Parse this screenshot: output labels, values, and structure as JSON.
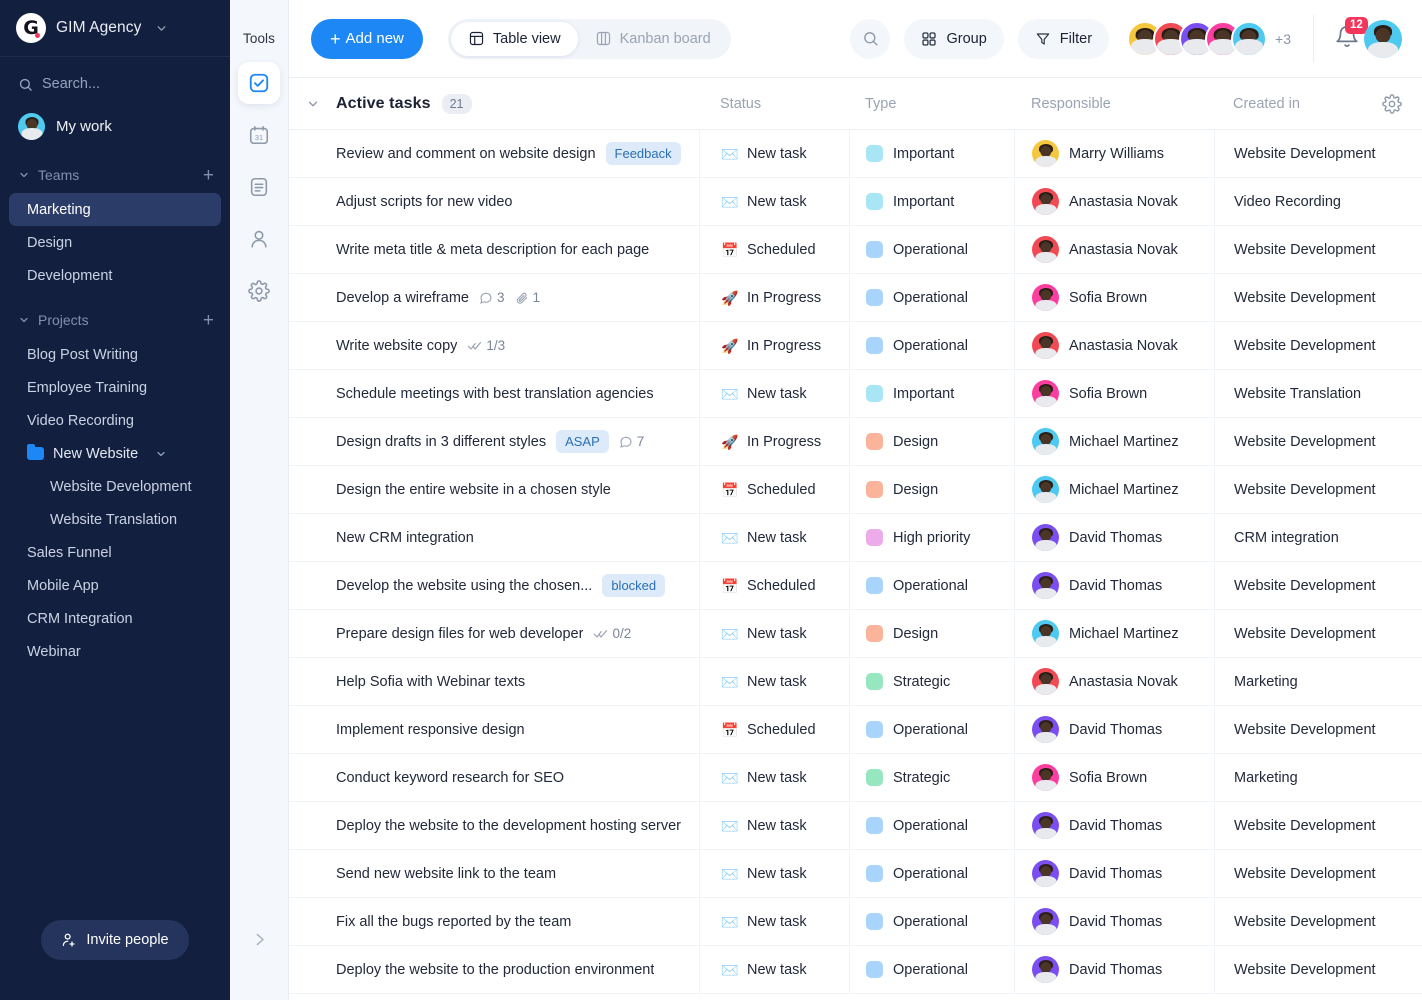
{
  "sidebar": {
    "brand": {
      "name": "GIM Agency",
      "logo_letter": "G",
      "caret_icon": "chevron-down-icon"
    },
    "search": {
      "placeholder": "Search...",
      "icon": "search-icon"
    },
    "my_work": {
      "label": "My work",
      "avatar": "user-avatar"
    },
    "teams": {
      "title": "Teams",
      "add_label": "+",
      "items": [
        {
          "label": "Marketing",
          "active": true
        },
        {
          "label": "Design",
          "active": false
        },
        {
          "label": "Development",
          "active": false
        }
      ]
    },
    "projects": {
      "title": "Projects",
      "add_label": "+",
      "items": [
        {
          "label": "Blog Post Writing",
          "type": "item"
        },
        {
          "label": "Employee Training",
          "type": "item"
        },
        {
          "label": "Video Recording",
          "type": "item"
        },
        {
          "label": "New Website",
          "type": "folder"
        },
        {
          "label": "Website Development",
          "type": "sub"
        },
        {
          "label": "Website Translation",
          "type": "sub"
        },
        {
          "label": "Sales Funnel",
          "type": "item"
        },
        {
          "label": "Mobile App",
          "type": "item"
        },
        {
          "label": "CRM Integration",
          "type": "item"
        },
        {
          "label": "Webinar",
          "type": "item"
        }
      ]
    },
    "invite": {
      "label": "Invite people",
      "icon": "user-plus-icon"
    }
  },
  "rail": {
    "title": "Tools",
    "items": [
      {
        "icon": "checkbox-check-icon",
        "active": true
      },
      {
        "icon": "calendar-icon",
        "active": false
      },
      {
        "icon": "document-icon",
        "active": false
      },
      {
        "icon": "person-icon",
        "active": false
      },
      {
        "icon": "gear-icon",
        "active": false
      }
    ],
    "expand_icon": "chevron-right-icon"
  },
  "topbar": {
    "add_new": "+ Add new",
    "add_new_label": "Add new",
    "views": [
      {
        "label": "Table view",
        "icon": "table-icon",
        "active": true
      },
      {
        "label": "Kanban board",
        "icon": "kanban-icon",
        "active": false
      }
    ],
    "search_icon": "search-icon",
    "group": {
      "label": "Group",
      "icon": "grid-icon"
    },
    "filter": {
      "label": "Filter",
      "icon": "funnel-icon"
    },
    "avatars_more": "+3",
    "notifications": {
      "count": "12",
      "icon": "bell-icon"
    },
    "profile": {
      "icon": "user-avatar"
    }
  },
  "table": {
    "group": {
      "label": "Active tasks",
      "count": "21",
      "toggle_icon": "chevron-down-icon"
    },
    "settings_icon": "gear-icon",
    "columns": [
      "Status",
      "Type",
      "Responsible",
      "Created in"
    ],
    "rows": [
      {
        "task": "Review and comment on website design",
        "tag": "Feedback",
        "meta": [],
        "status": "New task",
        "status_icon": "envelope",
        "type": "Important",
        "type_color": "#a8e6f5",
        "responsible": "Marry Williams",
        "avatar_color": "#f5c73e",
        "created": "Website Development"
      },
      {
        "task": "Adjust scripts for new video",
        "tag": "",
        "meta": [],
        "status": "New task",
        "status_icon": "envelope",
        "type": "Important",
        "type_color": "#a8e6f5",
        "responsible": "Anastasia Novak",
        "avatar_color": "#f04a54",
        "created": "Video Recording"
      },
      {
        "task": "Write meta title & meta description for each page",
        "tag": "",
        "meta": [],
        "status": "Scheduled",
        "status_icon": "calendar",
        "type": "Operational",
        "type_color": "#a9d4fb",
        "responsible": "Anastasia Novak",
        "avatar_color": "#f04a54",
        "created": "Website Development"
      },
      {
        "task": "Develop a wireframe",
        "tag": "",
        "meta": [
          {
            "icon": "comment-icon",
            "value": "3"
          },
          {
            "icon": "attachment-icon",
            "value": "1"
          }
        ],
        "status": "In Progress",
        "status_icon": "rocket",
        "type": "Operational",
        "type_color": "#a9d4fb",
        "responsible": "Sofia Brown",
        "avatar_color": "#fb3ea0",
        "created": "Website Development"
      },
      {
        "task": "Write website copy",
        "tag": "",
        "meta": [
          {
            "icon": "checklist-icon",
            "value": "1/3"
          }
        ],
        "status": "In Progress",
        "status_icon": "rocket",
        "type": "Operational",
        "type_color": "#a9d4fb",
        "responsible": "Anastasia Novak",
        "avatar_color": "#f04a54",
        "created": "Website Development"
      },
      {
        "task": "Schedule meetings with best translation agencies",
        "tag": "",
        "meta": [],
        "status": "New task",
        "status_icon": "envelope",
        "type": "Important",
        "type_color": "#a8e6f5",
        "responsible": "Sofia Brown",
        "avatar_color": "#fb3ea0",
        "created": "Website Translation"
      },
      {
        "task": "Design drafts in 3 different styles",
        "tag": "ASAP",
        "meta": [
          {
            "icon": "comment-icon",
            "value": "7"
          }
        ],
        "status": "In Progress",
        "status_icon": "rocket",
        "type": "Design",
        "type_color": "#fbb39b",
        "responsible": "Michael Martinez",
        "avatar_color": "#4ec9f0",
        "created": "Website Development"
      },
      {
        "task": "Design the entire website in a chosen style",
        "tag": "",
        "meta": [],
        "status": "Scheduled",
        "status_icon": "calendar",
        "type": "Design",
        "type_color": "#fbb39b",
        "responsible": "Michael Martinez",
        "avatar_color": "#4ec9f0",
        "created": "Website Development"
      },
      {
        "task": "New CRM integration",
        "tag": "",
        "meta": [],
        "status": "New task",
        "status_icon": "envelope",
        "type": "High priority",
        "type_color": "#eeabea",
        "responsible": "David Thomas",
        "avatar_color": "#7b4ef0",
        "created": "CRM integration"
      },
      {
        "task": "Develop the website using the chosen...",
        "tag": "blocked",
        "meta": [],
        "status": "Scheduled",
        "status_icon": "calendar",
        "type": "Operational",
        "type_color": "#a9d4fb",
        "responsible": "David Thomas",
        "avatar_color": "#7b4ef0",
        "created": "Website Development"
      },
      {
        "task": "Prepare design files for web developer",
        "tag": "",
        "meta": [
          {
            "icon": "checklist-icon",
            "value": "0/2"
          }
        ],
        "status": "New task",
        "status_icon": "envelope",
        "type": "Design",
        "type_color": "#fbb39b",
        "responsible": "Michael Martinez",
        "avatar_color": "#4ec9f0",
        "created": "Website Development"
      },
      {
        "task": "Help Sofia with Webinar texts",
        "tag": "",
        "meta": [],
        "status": "New task",
        "status_icon": "envelope",
        "type": "Strategic",
        "type_color": "#96e7c0",
        "responsible": "Anastasia Novak",
        "avatar_color": "#f04a54",
        "created": "Marketing"
      },
      {
        "task": "Implement responsive design",
        "tag": "",
        "meta": [],
        "status": "Scheduled",
        "status_icon": "calendar",
        "type": "Operational",
        "type_color": "#a9d4fb",
        "responsible": "David Thomas",
        "avatar_color": "#7b4ef0",
        "created": "Website Development"
      },
      {
        "task": "Conduct keyword research for SEO",
        "tag": "",
        "meta": [],
        "status": "New task",
        "status_icon": "envelope",
        "type": "Strategic",
        "type_color": "#96e7c0",
        "responsible": "Sofia Brown",
        "avatar_color": "#fb3ea0",
        "created": "Marketing"
      },
      {
        "task": "Deploy the website to the development hosting server",
        "tag": "",
        "meta": [],
        "status": "New task",
        "status_icon": "envelope",
        "type": "Operational",
        "type_color": "#a9d4fb",
        "responsible": "David Thomas",
        "avatar_color": "#7b4ef0",
        "created": "Website Development"
      },
      {
        "task": "Send new website link to the team",
        "tag": "",
        "meta": [],
        "status": "New task",
        "status_icon": "envelope",
        "type": "Operational",
        "type_color": "#a9d4fb",
        "responsible": "David Thomas",
        "avatar_color": "#7b4ef0",
        "created": "Website Development"
      },
      {
        "task": "Fix all the bugs reported by the team",
        "tag": "",
        "meta": [],
        "status": "New task",
        "status_icon": "envelope",
        "type": "Operational",
        "type_color": "#a9d4fb",
        "responsible": "David Thomas",
        "avatar_color": "#7b4ef0",
        "created": "Website Development"
      },
      {
        "task": "Deploy the website to the production environment",
        "tag": "",
        "meta": [],
        "status": "New task",
        "status_icon": "envelope",
        "type": "Operational",
        "type_color": "#a9d4fb",
        "responsible": "David Thomas",
        "avatar_color": "#7b4ef0",
        "created": "Website Development"
      }
    ]
  },
  "colors": {
    "sidebar_bg": "#131f3e",
    "accent": "#1d87f5",
    "badge_red": "#f4365a",
    "tag_bg": "#dceaf9",
    "tag_text": "#2b6fb5"
  },
  "topbar_avatars": [
    "#f5c73e",
    "#f04a54",
    "#7b4ef0",
    "#fb3ea0",
    "#4ec9f0"
  ]
}
